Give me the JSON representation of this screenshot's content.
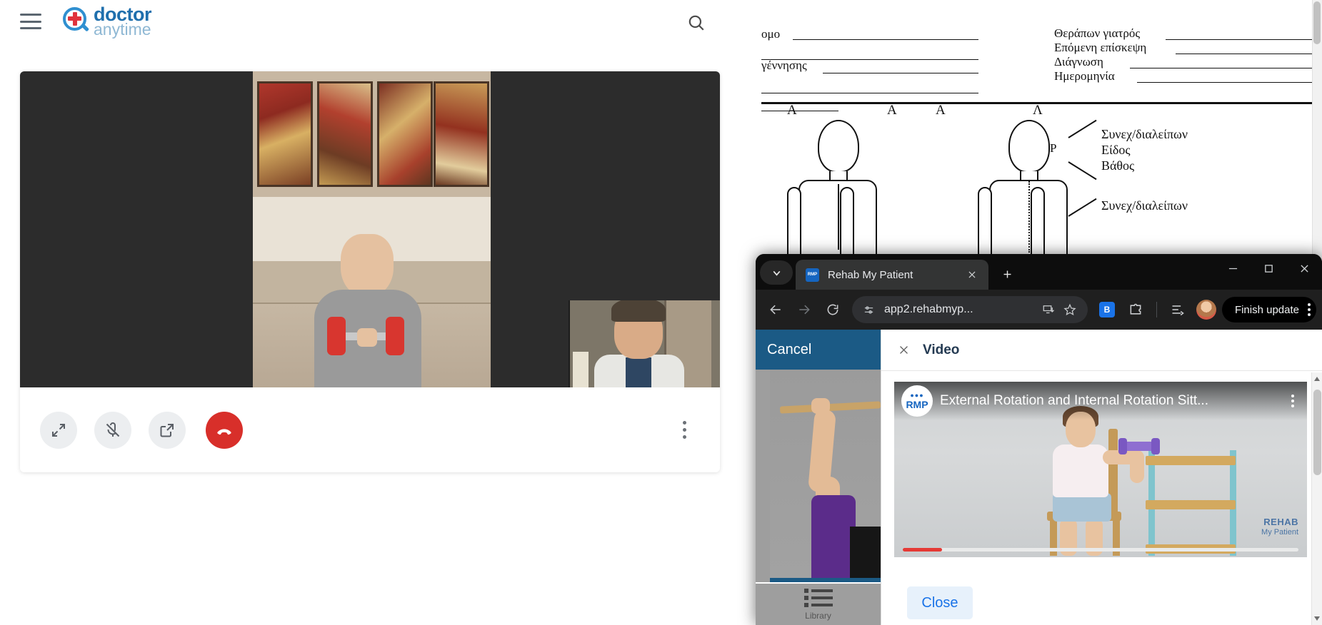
{
  "telehealth": {
    "brand": {
      "top": "doctor",
      "bottom": "anytime"
    },
    "menu_icon": "hamburger-icon",
    "search_icon": "search-icon",
    "controls": [
      {
        "name": "fullscreen",
        "label": "Fullscreen"
      },
      {
        "name": "microphone-muted",
        "label": "Microphone muted"
      },
      {
        "name": "share-screen",
        "label": "Share"
      },
      {
        "name": "end-call",
        "label": "End call"
      }
    ],
    "more_label": "More options"
  },
  "document": {
    "left_fields": [
      "ομο",
      "γέννησης"
    ],
    "right_fields": [
      "Θεράπων γιατρός",
      "Επόμενη επίσκεψη",
      "Διάγνωση",
      "Ημερομηνία"
    ],
    "figure_labels": [
      "Α",
      "Α",
      "Α",
      "Λ"
    ],
    "pain_marker": "Ρ",
    "annotations_group_1": [
      "Συνεχ/διαλείπων",
      "Είδος",
      "Βάθος"
    ],
    "annotations_group_2": [
      "Συνεχ/διαλείπων"
    ]
  },
  "browser": {
    "tab": {
      "title": "Rehab My Patient",
      "favicon_initials": "RMP",
      "favicon_sub": "so ys",
      "close_label": "Close tab"
    },
    "tab_search_label": "Search tabs",
    "new_tab_label": "New tab",
    "window_controls": [
      "minimize",
      "maximize",
      "close"
    ],
    "toolbar": {
      "back_label": "Back",
      "forward_label": "Forward",
      "reload_label": "Reload",
      "url": "app2.rehabmyp...",
      "site_settings_label": "View site information",
      "install_label": "Install app",
      "bookmark_label": "Bookmark this tab",
      "extension_badge": "B",
      "side_panel_label": "Side panel",
      "reading_list_label": "Reading list",
      "profile_label": "Profile",
      "finish_update_label": "Finish update",
      "more_label": "Customize and control Chrome"
    }
  },
  "rehab_app": {
    "cancel_label": "Cancel",
    "tab_label": "Library",
    "modal": {
      "close_icon_label": "Close",
      "title": "Video",
      "player": {
        "logo": "RMP",
        "title": "External Rotation and Internal Rotation Sitt...",
        "menu_label": "More actions",
        "watermark_top": "REHAB",
        "watermark_bottom": "My Patient",
        "progress_percent": 10
      },
      "close_button_label": "Close"
    }
  },
  "colors": {
    "brand_blue": "#1f6fad",
    "brand_red": "#e0333c",
    "rmp_header_blue": "#1b5a85",
    "accent_link_blue": "#1a73e8",
    "hangup_red": "#d82f2a",
    "progress_red": "#e53935"
  }
}
